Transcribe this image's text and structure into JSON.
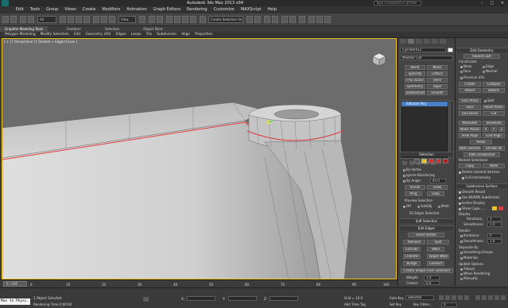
{
  "window": {
    "title": "Autodesk 3ds Max 2013 x64",
    "search_placeholder": "Type a keyword or phrase"
  },
  "menu": [
    "Edit",
    "Tools",
    "Group",
    "Views",
    "Create",
    "Modifiers",
    "Animation",
    "Graph Editors",
    "Rendering",
    "Customize",
    "MAXScript",
    "Help"
  ],
  "toolbar": {
    "selection_filter": "All",
    "ref_coord": "View",
    "named_selection": "Create Selection Se"
  },
  "ribbon": {
    "tabs": [
      "Graphite Modeling Tools",
      "Freeform",
      "Selection",
      "Object Paint"
    ],
    "items": [
      "Polygon Modeling",
      "Modify Selection",
      "Edit",
      "Geometry (All)",
      "Edges",
      "Loops",
      "Tris",
      "Subdivision",
      "Align",
      "Properties"
    ]
  },
  "viewport": {
    "label": "[ + ] [ Perspective ] [ Shaded + Edged Faces ]"
  },
  "command_panel": {
    "object_name": "Cylinder012",
    "modifier_list": "Modifier List",
    "modifier_buttons": [
      "Bend",
      "Noise",
      "Spherify",
      "Lattice",
      "FFD 3x3x3",
      "Shell",
      "Symmetry",
      "Taper",
      "TurboSmooth",
      "Smooth"
    ],
    "stack_item": "Editable Poly",
    "selection_header": "Selection",
    "by_vertex": "By Vertex",
    "ignore_backfacing": "Ignore Backfacing",
    "by_angle": "By Angle:",
    "by_angle_value": "45.0",
    "shrink": "Shrink",
    "grow": "Grow",
    "ring": "Ring",
    "loop": "Loop",
    "preview_selection": "Preview Selection",
    "preview_off": "Off",
    "preview_subobj": "SubObj",
    "preview_multi": "Multi",
    "status": "62 Edges Selected",
    "soft_selection": "Soft Selection",
    "edit_edges": "Edit Edges",
    "insert_vertex": "Insert Vertex",
    "remove": "Remove",
    "split": "Split",
    "extrude": "Extrude",
    "weld": "Weld",
    "chamfer": "Chamfer",
    "target_weld": "Target Weld",
    "bridge": "Bridge",
    "connect": "Connect",
    "create_shape": "Create Shape From Selection",
    "weight_label": "Weight:",
    "weight_value": "1.0",
    "crease_label": "Crease:",
    "crease_value": "0.0"
  },
  "command_panel2": {
    "edit_geometry": "Edit Geometry",
    "repeat_last": "Repeat Last",
    "constraints": "Constraints",
    "none": "None",
    "edge": "Edge",
    "face": "Face",
    "normal": "Normal",
    "preserve_uvs": "Preserve UVs",
    "create": "Create",
    "collapse": "Collapse",
    "attach": "Attach",
    "detach": "Detach",
    "slice_plane": "Slice Plane",
    "split": "Split",
    "slice": "Slice",
    "reset_plane": "Reset Plane",
    "quickslice": "QuickSlice",
    "cut": "Cut",
    "msmooth": "MSmooth",
    "tessellate": "Tessellate",
    "make_planar": "Make Planar",
    "x": "X",
    "y": "Y",
    "z": "Z",
    "view_align": "View Align",
    "grid_align": "Grid Align",
    "relax": "Relax",
    "hide_selected": "Hide Selected",
    "unhide_all": "Unhide All",
    "hide_unselected": "Hide Unselected",
    "named_selections": "Named Selections:",
    "copy": "Copy",
    "paste": "Paste",
    "delete_isolated": "Delete Isolated Vertices",
    "full_interactivity": "Full Interactivity",
    "subdivision_surface": "Subdivision Surface",
    "smooth_result": "Smooth Result",
    "use_nurms": "Use NURMS Subdivision",
    "isoline_display": "Isoline Display",
    "show_cage": "Show Cage......",
    "display": "Display",
    "iterations_label": "Iterations:",
    "iterations_value": "1",
    "smoothness_label": "Smoothness:",
    "smoothness_value": "1.0",
    "render": "Render",
    "render_iterations_value": "0",
    "render_smoothness_value": "1.0",
    "separate_by": "Separate By",
    "smoothing_groups": "Smoothing Groups",
    "materials": "Materials",
    "update_options": "Update Options",
    "always": "Always",
    "when_rendering": "When Rendering",
    "manually": "Manually"
  },
  "timeline": {
    "frame": "0 / 100",
    "ticks": [
      "0",
      "10",
      "20",
      "30",
      "40",
      "50",
      "60",
      "70",
      "80",
      "90",
      "100"
    ]
  },
  "status": {
    "objects_selected": "1 Object Selected",
    "rendering_time": "Rendering Time 0:00:00",
    "maxscript": "Max to Physc.",
    "x_label": "X:",
    "y_label": "Y:",
    "z_label": "Z:",
    "grid": "Grid = 10.0",
    "add_time_tag": "Add Time Tag",
    "auto_key": "Auto Key",
    "set_key": "Set Key",
    "selected": "Selected",
    "key_filters": "Key Filters...",
    "frame_value": "0"
  },
  "colors": {
    "viewport_bg": "#6c6c6c",
    "active_border": "#f0c020",
    "edge_selected": "#e03a3a",
    "stack_highlight": "#4a7fc6"
  }
}
